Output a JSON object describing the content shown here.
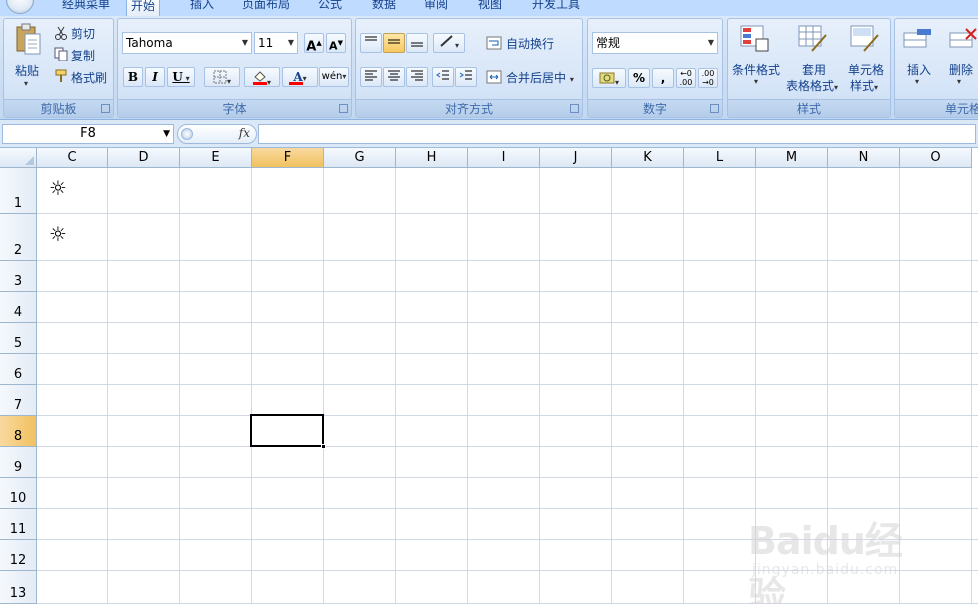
{
  "tabs": [
    {
      "label": "经典菜单"
    },
    {
      "label": "开始"
    },
    {
      "label": "插入"
    },
    {
      "label": "页面布局"
    },
    {
      "label": "公式"
    },
    {
      "label": "数据"
    },
    {
      "label": "审阅"
    },
    {
      "label": "视图"
    },
    {
      "label": "开发工具"
    }
  ],
  "ribbon": {
    "clipboard": {
      "paste": "粘贴",
      "cut": "剪切",
      "copy": "复制",
      "format_painter": "格式刷",
      "group": "剪贴板"
    },
    "font": {
      "name": "Tahoma",
      "size": "11",
      "bold": "B",
      "italic": "I",
      "underline": "U",
      "font_color_glyph": "A",
      "group": "字体"
    },
    "alignment": {
      "wrap": "自动换行",
      "merge": "合并后居中",
      "group": "对齐方式"
    },
    "number": {
      "format": "常规",
      "percent": "%",
      "comma": ",",
      "group": "数字"
    },
    "styles": {
      "conditional_format": "条件格式",
      "table_format_1": "套用",
      "table_format_2": "表格格式",
      "cell_style_1": "单元格",
      "cell_style_2": "样式",
      "group": "样式"
    },
    "cells": {
      "insert": "插入",
      "delete": "删除",
      "group": "单元格"
    }
  },
  "formula_bar": {
    "name_box": "F8",
    "fx": "fx",
    "value": ""
  },
  "grid": {
    "columns": [
      "C",
      "D",
      "E",
      "F",
      "G",
      "H",
      "I",
      "J",
      "K",
      "L",
      "M",
      "N",
      "O"
    ],
    "rows": [
      "1",
      "2",
      "3",
      "4",
      "5",
      "6",
      "7",
      "8",
      "9",
      "10",
      "11",
      "12",
      "13"
    ],
    "active_cell": "F8",
    "cells": {
      "C1": "☼",
      "C2": "☼"
    }
  },
  "watermark": {
    "brand": "Baidu经验",
    "url": "jingyan.baidu.com"
  },
  "colors": {
    "ribbon_bg": "#c9dcf3",
    "tab_text": "#15428b",
    "active_header": "#f1c15f",
    "gridline": "#d0d7e5"
  }
}
